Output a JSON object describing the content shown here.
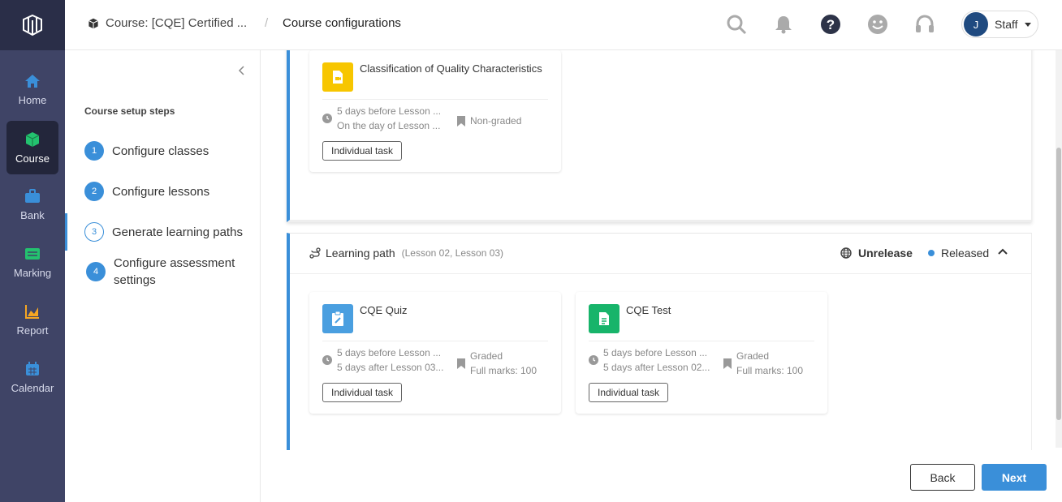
{
  "appnav": {
    "items": [
      {
        "label": "Home",
        "icon": "home-icon"
      },
      {
        "label": "Course",
        "icon": "cube-icon"
      },
      {
        "label": "Bank",
        "icon": "briefcase-icon"
      },
      {
        "label": "Marking",
        "icon": "marking-icon"
      },
      {
        "label": "Report",
        "icon": "chart-icon"
      },
      {
        "label": "Calendar",
        "icon": "calendar-icon"
      }
    ],
    "active": "Course"
  },
  "header": {
    "course": "Course: [CQE] Certified ...",
    "separator": "/",
    "page": "Course configurations",
    "user_initial": "J",
    "user_label": "Staff"
  },
  "steps": {
    "title": "Course setup steps",
    "items": [
      {
        "num": "1",
        "label": "Configure classes"
      },
      {
        "num": "2",
        "label": "Configure lessons"
      },
      {
        "num": "3",
        "label": "Generate learning paths"
      },
      {
        "num": "4",
        "label": "Configure assessment settings"
      }
    ]
  },
  "section1": {
    "card": {
      "title": "Classification of Quality Characteristics",
      "date1": "5 days before Lesson ...",
      "date2": "On the day of Lesson ...",
      "grade": "Non-graded",
      "tag": "Individual task"
    }
  },
  "section2": {
    "title": "Learning path",
    "lessons": "(Lesson 02, Lesson 03)",
    "unrelease": "Unrelease",
    "released": "Released",
    "cards": [
      {
        "title": "CQE Quiz",
        "date1": "5 days before Lesson ...",
        "date2": "5 days after Lesson 03...",
        "grade": "Graded",
        "marks": "Full marks: 100",
        "tag": "Individual task"
      },
      {
        "title": "CQE Test",
        "date1": "5 days before Lesson ...",
        "date2": "5 days after Lesson 02...",
        "grade": "Graded",
        "marks": "Full marks: 100",
        "tag": "Individual task"
      }
    ]
  },
  "footer": {
    "back": "Back",
    "next": "Next"
  },
  "colors": {
    "accent": "#3a8fd9",
    "nav_bg": "#3f4466",
    "yellow_icon": "#f7c600",
    "blue_icon": "#4a9fe0",
    "green_icon": "#17b46a"
  }
}
